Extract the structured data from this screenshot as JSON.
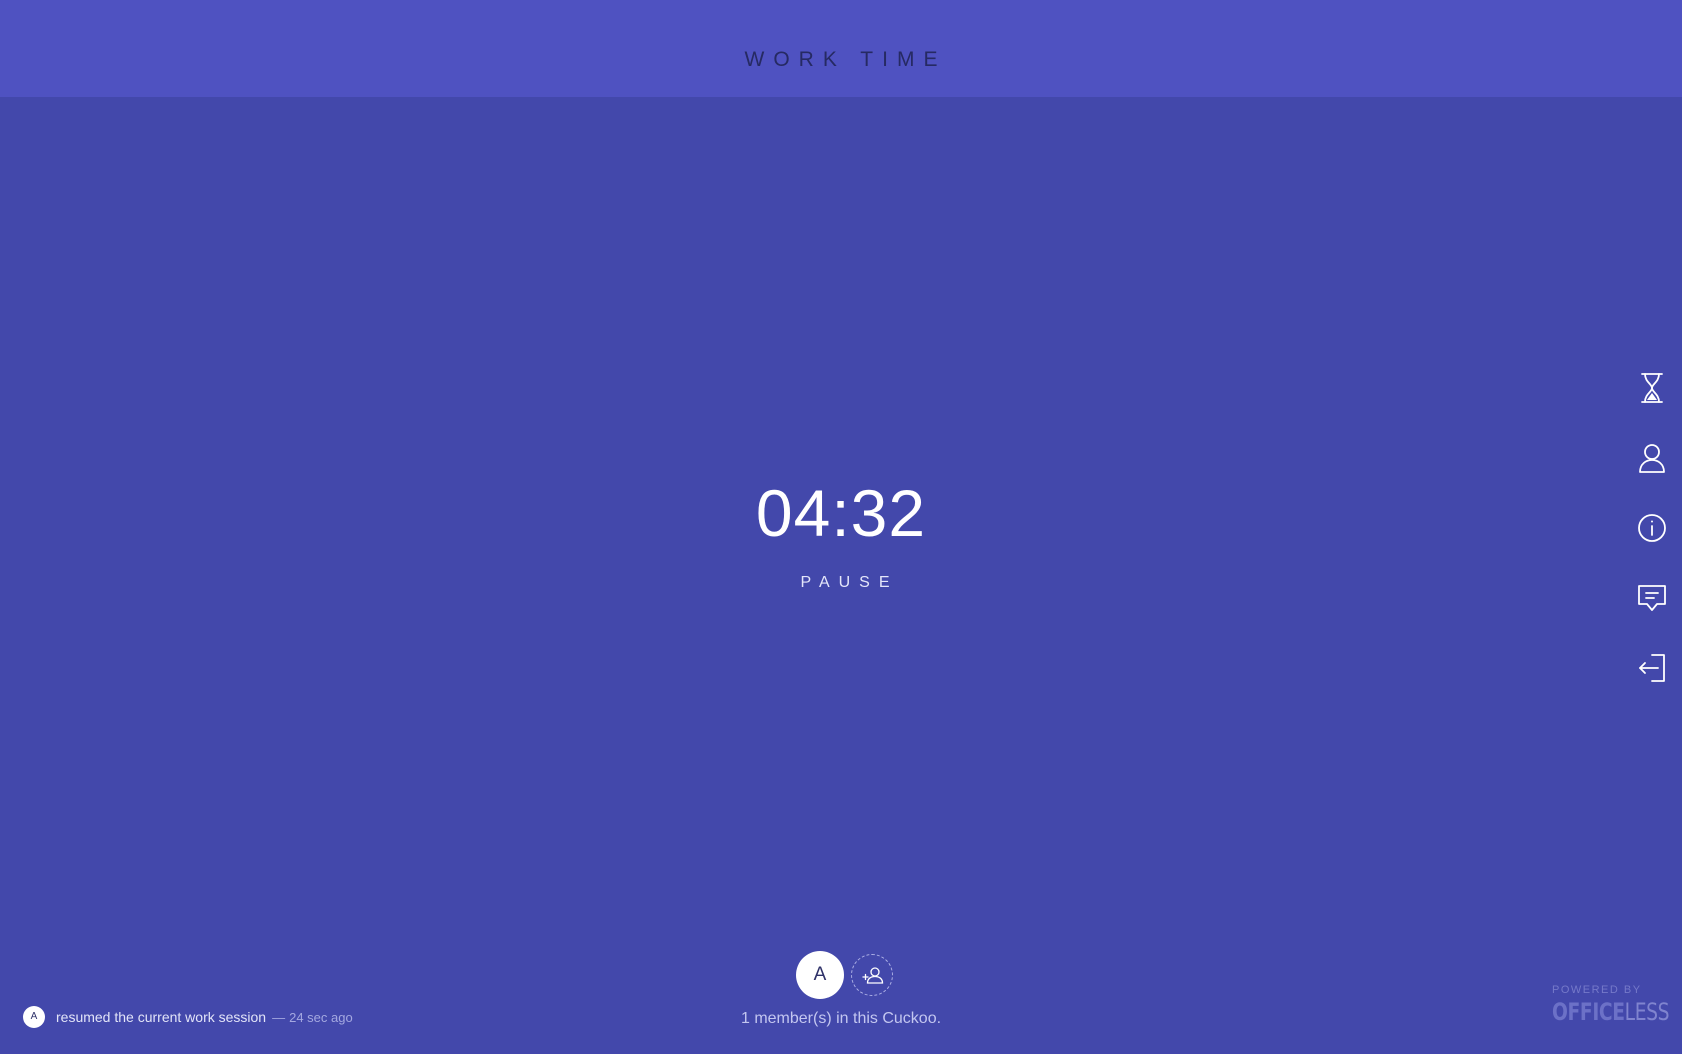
{
  "header": {
    "title": "WORK TIME"
  },
  "timer": {
    "value": "04:32",
    "pause_label": "PAUSE"
  },
  "sidebar": {
    "items": [
      {
        "icon": "hourglass-icon"
      },
      {
        "icon": "user-icon"
      },
      {
        "icon": "info-icon"
      },
      {
        "icon": "chat-icon"
      },
      {
        "icon": "logout-icon"
      }
    ]
  },
  "members": {
    "avatar_initial": "A",
    "invite_icon": "add-user-icon",
    "count_text": "1 member(s) in this Cuckoo."
  },
  "activity": {
    "avatar_initial": "A",
    "message": "resumed the current work session",
    "separator": "—",
    "time": "24 sec ago"
  },
  "footer": {
    "powered_label": "POWERED BY",
    "brand_bold": "OFFICE",
    "brand_light": "LESS"
  },
  "colors": {
    "background": "#4348ab",
    "header_background": "#4f52c1",
    "header_text": "#262a63",
    "text": "#ffffff"
  }
}
